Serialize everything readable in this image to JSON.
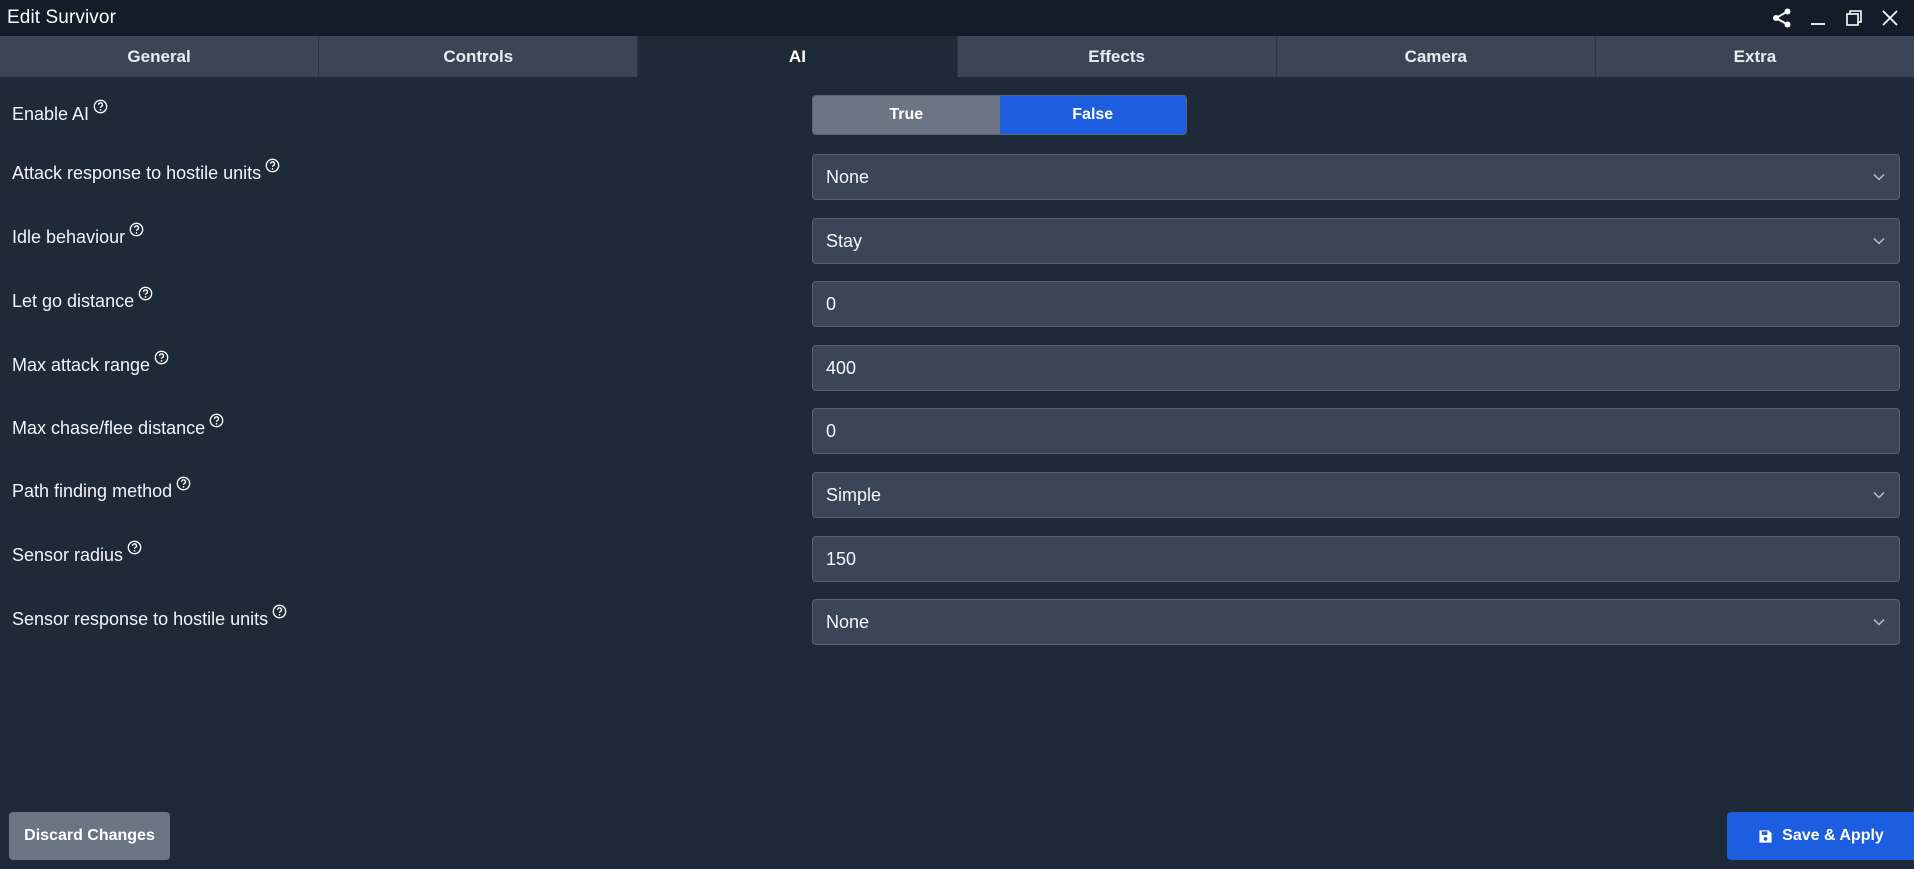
{
  "window": {
    "title": "Edit Survivor",
    "controls": [
      "share-icon",
      "minimize-icon",
      "restore-icon",
      "close-icon"
    ]
  },
  "tabs": [
    {
      "label": "General",
      "active": false
    },
    {
      "label": "Controls",
      "active": false
    },
    {
      "label": "AI",
      "active": true
    },
    {
      "label": "Effects",
      "active": false
    },
    {
      "label": "Camera",
      "active": false
    },
    {
      "label": "Extra",
      "active": false
    }
  ],
  "fields": {
    "enable_ai": {
      "label": "Enable AI",
      "options": [
        "True",
        "False"
      ],
      "selected": "False"
    },
    "attack_response": {
      "label": "Attack response to hostile units",
      "value": "None"
    },
    "idle_behaviour": {
      "label": "Idle behaviour",
      "value": "Stay"
    },
    "let_go_distance": {
      "label": "Let go distance",
      "value": "0"
    },
    "max_attack_range": {
      "label": "Max attack range",
      "value": "400"
    },
    "max_chase_flee": {
      "label": "Max chase/flee distance",
      "value": "0"
    },
    "path_finding": {
      "label": "Path finding method",
      "value": "Simple"
    },
    "sensor_radius": {
      "label": "Sensor radius",
      "value": "150"
    },
    "sensor_response": {
      "label": "Sensor response to hostile units",
      "value": "None"
    }
  },
  "footer": {
    "discard_label": "Discard Changes",
    "save_label": "Save & Apply"
  },
  "colors": {
    "background": "#1f2a39",
    "titlebar": "#141c29",
    "tab_bar": "#3a4556",
    "accent": "#1d5ee0",
    "neutral_button": "#6b7583"
  }
}
